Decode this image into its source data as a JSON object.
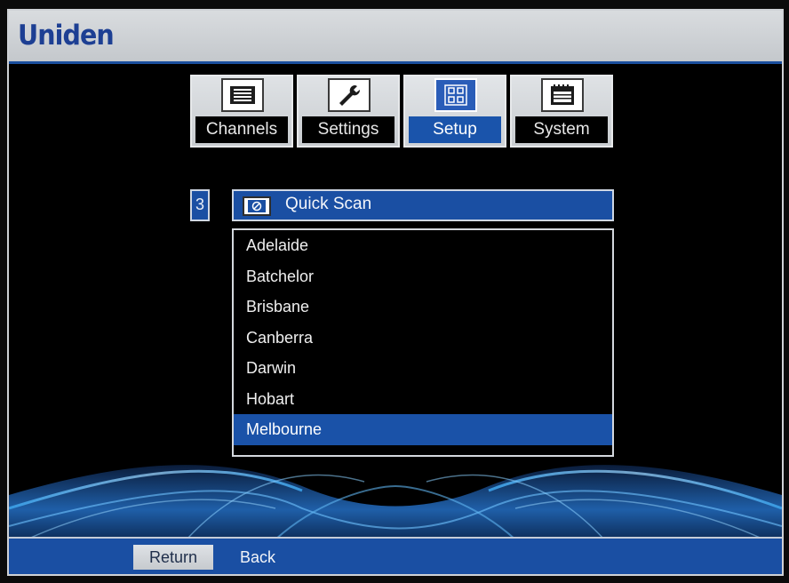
{
  "brand": "Uniden",
  "tabs": [
    {
      "label": "Channels",
      "icon": "list-icon",
      "active": false
    },
    {
      "label": "Settings",
      "icon": "wrench-icon",
      "active": false
    },
    {
      "label": "Setup",
      "icon": "grid-icon",
      "active": true
    },
    {
      "label": "System",
      "icon": "calendar-icon",
      "active": false
    }
  ],
  "quick_scan": {
    "number": "3",
    "icon": "scan-icon",
    "label": "Quick Scan"
  },
  "cities": [
    "Adelaide",
    "Batchelor",
    "Brisbane",
    "Canberra",
    "Darwin",
    "Hobart",
    "Melbourne"
  ],
  "selected_city": "Melbourne",
  "footer": {
    "return_key": "Return",
    "back_label": "Back"
  },
  "colors": {
    "header_bg": "#c4c8cc",
    "brand_text": "#1d3f93",
    "accent_blue": "#1a4fa3",
    "selected_row": "#1a52a8",
    "background": "#000000"
  }
}
